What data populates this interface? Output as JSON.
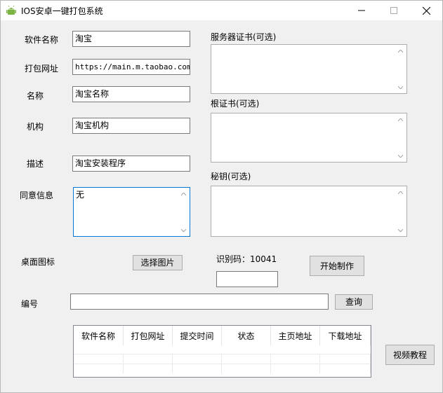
{
  "window": {
    "title": "IOS安卓一键打包系统"
  },
  "form": {
    "software_name_label": "软件名称",
    "software_name_value": "淘宝",
    "package_url_label": "打包网址",
    "package_url_value": "https://main.m.taobao.com/",
    "name_label": "名称",
    "name_value": "淘宝名称",
    "org_label": "机构",
    "org_value": "淘宝机构",
    "desc_label": "描述",
    "desc_value": "淘宝安装程序",
    "consent_label": "同意信息",
    "consent_value": "无",
    "desktop_icon_label": "桌面图标",
    "select_image_button": "选择图片",
    "number_label": "编号",
    "number_value": "",
    "query_button": "查询"
  },
  "certs": {
    "server_cert_label": "服务器证书(可选)",
    "server_cert_value": "",
    "root_cert_label": "根证书(可选)",
    "root_cert_value": "",
    "secret_key_label": "秘钥(可选)",
    "secret_key_value": ""
  },
  "build": {
    "id_code_label": "识别码：10041",
    "id_code_input": "",
    "start_button": "开始制作"
  },
  "table": {
    "columns": [
      "软件名称",
      "打包网址",
      "提交时间",
      "状态",
      "主页地址",
      "下载地址"
    ],
    "rows": []
  },
  "video_button": "视频教程"
}
